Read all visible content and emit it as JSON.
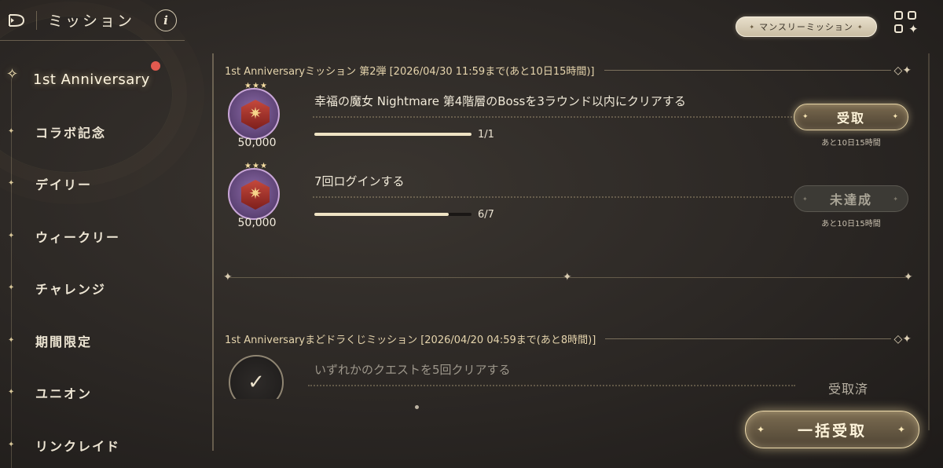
{
  "header": {
    "title": "ミッション",
    "info_label": "i"
  },
  "top_right": {
    "monthly_button": "マンスリーミッション"
  },
  "sidebar": {
    "items": [
      {
        "label": "1st Anniversary",
        "active": true,
        "badge": true
      },
      {
        "label": "コラボ記念"
      },
      {
        "label": "デイリー"
      },
      {
        "label": "ウィークリー"
      },
      {
        "label": "チャレンジ"
      },
      {
        "label": "期間限定"
      },
      {
        "label": "ユニオン"
      },
      {
        "label": "リンクレイド"
      }
    ]
  },
  "sections": [
    {
      "header": "1st Anniversaryミッション 第2弾 [2026/04/30 11:59まで(あと10日15時間)]",
      "missions": [
        {
          "title": "幸福の魔女 Nightmare 第4階層のBossを3ラウンド以内にクリアする",
          "reward": "50,000",
          "progress_text": "1/1",
          "progress": 1.0,
          "button": "受取",
          "remaining": "あと10日15時間"
        },
        {
          "title": "7回ログインする",
          "reward": "50,000",
          "progress_text": "6/7",
          "progress": 0.857,
          "button": "未達成",
          "remaining": "あと10日15時間"
        }
      ]
    },
    {
      "header": "1st Anniversaryまどドラくじミッション [2026/04/20 04:59まで(あと8時間)]",
      "missions": [
        {
          "title": "いずれかのクエストを5回クリアする",
          "status": "受取済"
        }
      ]
    }
  ],
  "bulk_button": "一括受取"
}
